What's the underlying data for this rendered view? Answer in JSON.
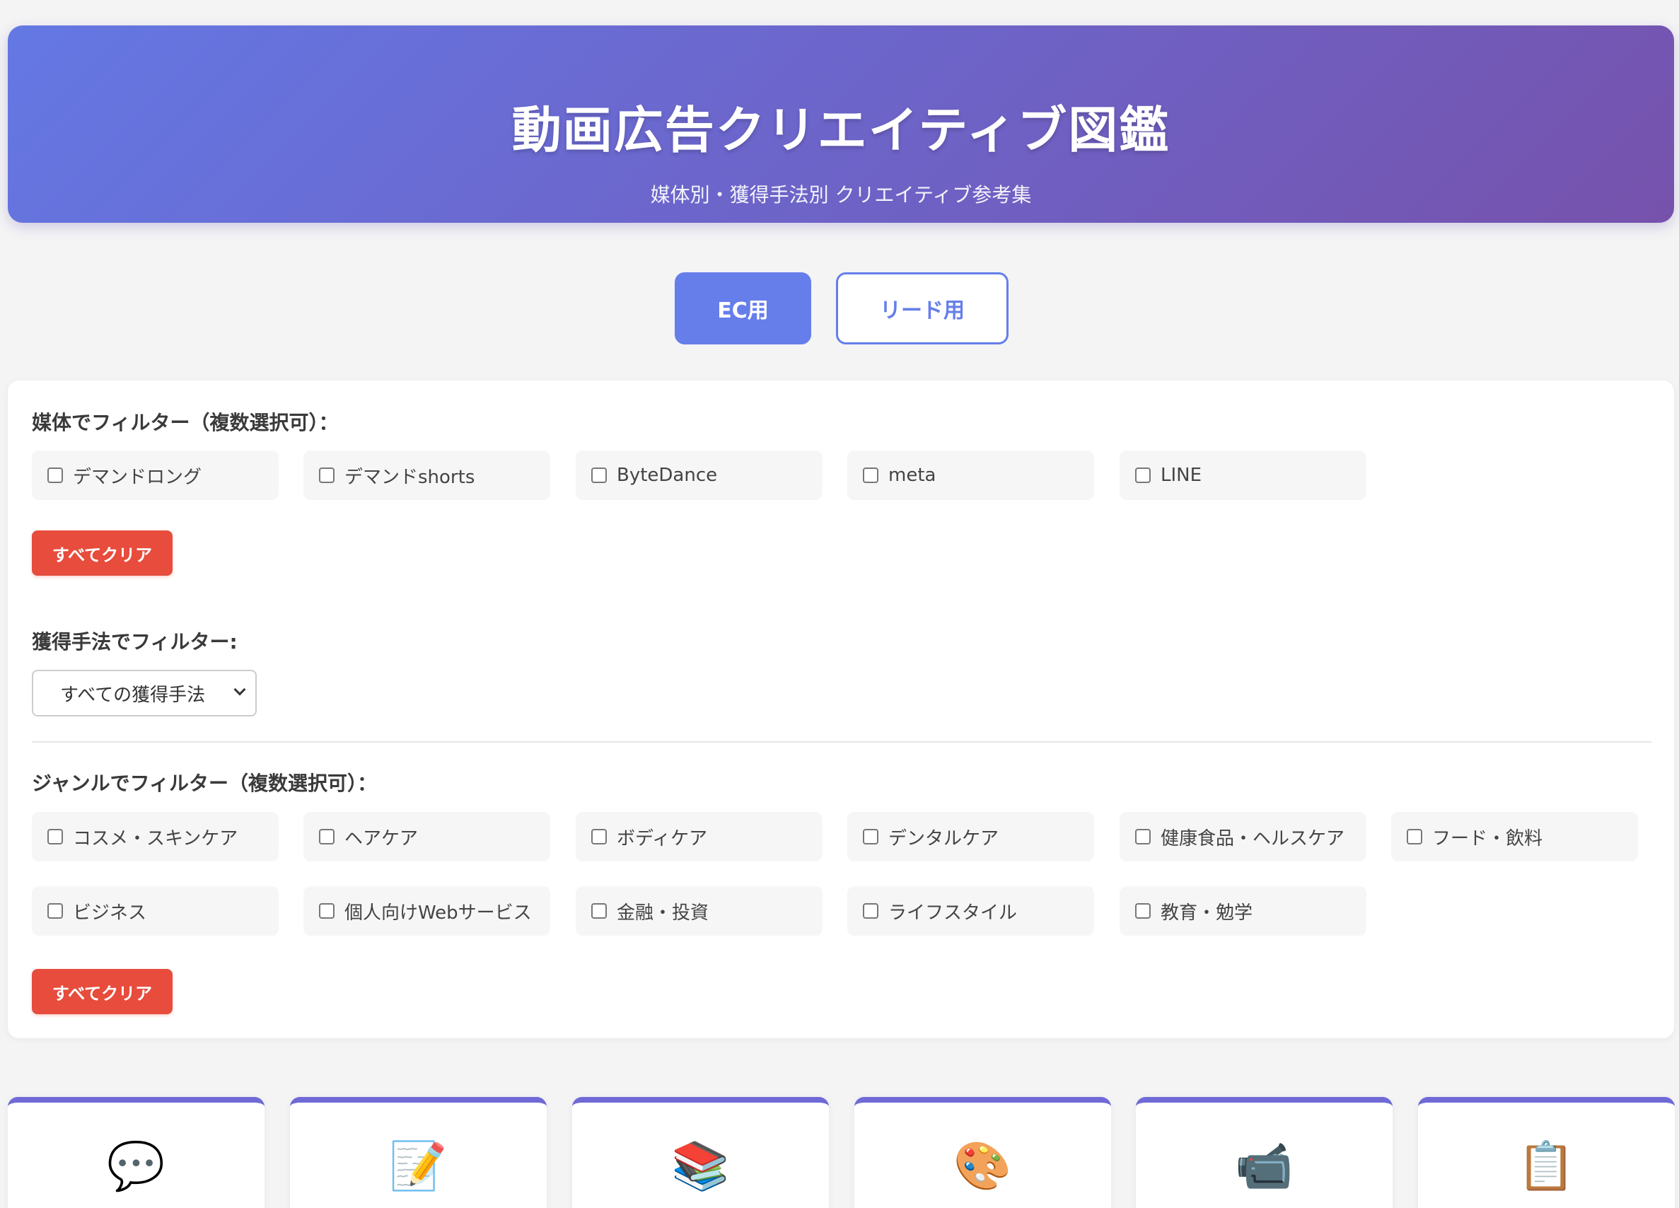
{
  "header": {
    "title": "動画広告クリエイティブ図鑑",
    "subtitle": "媒体別・獲得手法別 クリエイティブ参考集"
  },
  "mode_tabs": {
    "ec": "EC用",
    "lead": "リード用",
    "active": "EC用"
  },
  "media_filter": {
    "label": "媒体でフィルター（複数選択可）：",
    "options": [
      "デマンドロング",
      "デマンドshorts",
      "ByteDance",
      "meta",
      "LINE"
    ],
    "clear_label": "すべてクリア"
  },
  "method_filter": {
    "label": "獲得手法でフィルター:",
    "selected": "すべての獲得手法"
  },
  "genre_filter": {
    "label": "ジャンルでフィルター（複数選択可）：",
    "options": [
      "コスメ・スキンケア",
      "ヘアケア",
      "ボディケア",
      "デンタルケア",
      "健康食品・ヘルスケア",
      "フード・飲料",
      "ビジネス",
      "個人向けWebサービス",
      "金融・投資",
      "ライフスタイル",
      "教育・勉学"
    ],
    "clear_label": "すべてクリア"
  },
  "cards": [
    {
      "icon": "speech-bubble-icon",
      "glyph": "💬"
    },
    {
      "icon": "memo-pencil-icon",
      "glyph": "📝"
    },
    {
      "icon": "books-icon",
      "glyph": "📚"
    },
    {
      "icon": "palette-icon",
      "glyph": "🎨"
    },
    {
      "icon": "video-camera-icon",
      "glyph": "📹"
    },
    {
      "icon": "clipboard-icon",
      "glyph": "📋"
    }
  ],
  "colors": {
    "header_gradient_start": "#6478e4",
    "header_gradient_end": "#7652ac",
    "accent": "#667eea",
    "clear_button": "#e74c3c"
  }
}
